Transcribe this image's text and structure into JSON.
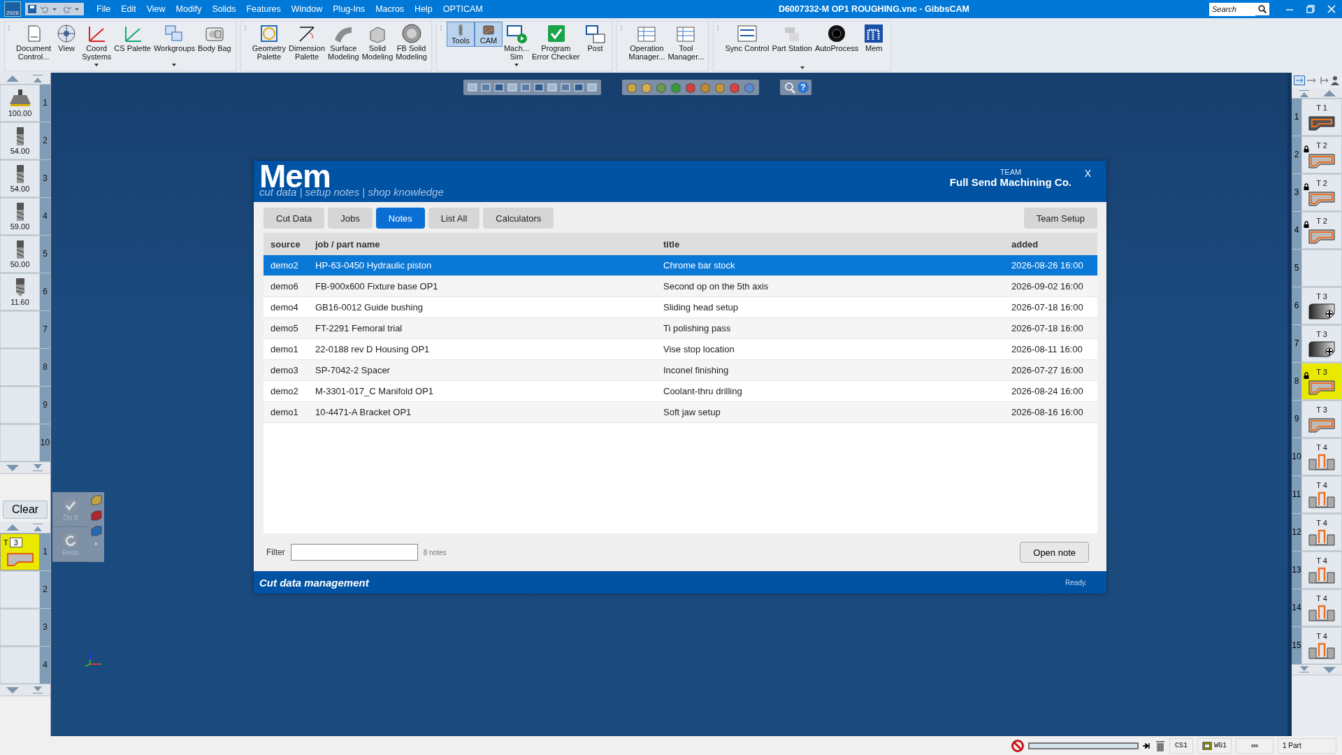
{
  "title_bar": {
    "app_badge": "2026",
    "menu": [
      "File",
      "Edit",
      "View",
      "Modify",
      "Solids",
      "Features",
      "Window",
      "Plug-Ins",
      "Macros",
      "Help",
      "OPTICAM"
    ],
    "title": "D6007332-M OP1 ROUGHING.vnc - GibbsCAM",
    "search_placeholder": "Search"
  },
  "toolbar": [
    {
      "buttons": [
        {
          "label": "Document\nControl...",
          "selected": false,
          "dropdown": false
        },
        {
          "label": "View",
          "selected": false,
          "dropdown": false
        },
        {
          "label": "Coord\nSystems",
          "selected": false,
          "dropdown": true
        },
        {
          "label": "CS Palette",
          "selected": false,
          "dropdown": false
        },
        {
          "label": "Workgroups",
          "selected": false,
          "dropdown": true
        },
        {
          "label": "Body Bag",
          "selected": false,
          "dropdown": false
        }
      ]
    },
    {
      "buttons": [
        {
          "label": "Geometry\nPalette",
          "selected": false,
          "dropdown": false
        },
        {
          "label": "Dimension\nPalette",
          "selected": false,
          "dropdown": false
        },
        {
          "label": "Surface\nModeling",
          "selected": false,
          "dropdown": false
        },
        {
          "label": "Solid\nModeling",
          "selected": false,
          "dropdown": false
        },
        {
          "label": "FB Solid\nModeling",
          "selected": false,
          "dropdown": false
        }
      ]
    },
    {
      "buttons": [
        {
          "label": "Tools",
          "selected": true,
          "dropdown": false
        },
        {
          "label": "CAM",
          "selected": true,
          "dropdown": false
        },
        {
          "label": "Mach...\nSim",
          "selected": false,
          "dropdown": true
        },
        {
          "label": "Program\nError Checker",
          "selected": false,
          "dropdown": false
        },
        {
          "label": "Post",
          "selected": false,
          "dropdown": false
        }
      ]
    },
    {
      "buttons": [
        {
          "label": "Operation\nManager...",
          "selected": false,
          "dropdown": false
        },
        {
          "label": "Tool\nManager...",
          "selected": false,
          "dropdown": false
        }
      ]
    },
    {
      "buttons": [
        {
          "label": "Sync Control",
          "selected": false,
          "dropdown": false
        },
        {
          "label": "Part Station",
          "selected": false,
          "dropdown": false
        },
        {
          "label": "AutoProcess",
          "selected": false,
          "dropdown": false
        },
        {
          "label": "Mem",
          "selected": false,
          "dropdown": false
        }
      ],
      "dropdown": true
    }
  ],
  "canvas_toolbar": {
    "help": "?"
  },
  "tool_list": [
    {
      "number": "1",
      "diameter": "100.00",
      "kind": "face_mill"
    },
    {
      "number": "2",
      "diameter": "54.00",
      "kind": "end_mill"
    },
    {
      "number": "3",
      "diameter": "54.00",
      "kind": "end_mill"
    },
    {
      "number": "4",
      "diameter": "59.00",
      "kind": "end_mill"
    },
    {
      "number": "5",
      "diameter": "50.00",
      "kind": "end_mill"
    },
    {
      "number": "6",
      "diameter": "11.60",
      "kind": "drill"
    },
    {
      "number": "7"
    },
    {
      "number": "8"
    },
    {
      "number": "9"
    },
    {
      "number": "10"
    }
  ],
  "clear_button": "Clear",
  "process_panel": {
    "do_it": "Do It",
    "redo": "Redo",
    "disabled": true
  },
  "process_list": [
    {
      "number": "1",
      "tool_label": "T",
      "tool": "3",
      "selected": true
    },
    {
      "number": "2",
      "selected": false
    },
    {
      "number": "3",
      "selected": false
    },
    {
      "number": "4",
      "selected": false
    }
  ],
  "operations": [
    {
      "number": "1",
      "tool": "T 1",
      "kind": "contour",
      "locked": false,
      "selected": false
    },
    {
      "number": "2",
      "tool": "T 2",
      "kind": "pocket",
      "locked": true,
      "selected": false
    },
    {
      "number": "3",
      "tool": "T 2",
      "kind": "pocket",
      "locked": true,
      "selected": false
    },
    {
      "number": "4",
      "tool": "T 2",
      "kind": "pocket",
      "locked": true,
      "selected": false
    },
    {
      "number": "5",
      "locked": false,
      "selected": false
    },
    {
      "number": "6",
      "tool": "T 3",
      "kind": "hole",
      "locked": false,
      "selected": false
    },
    {
      "number": "7",
      "tool": "T 3",
      "kind": "hole",
      "locked": false,
      "selected": false
    },
    {
      "number": "8",
      "tool": "T 3",
      "kind": "pocket",
      "locked": true,
      "selected": true
    },
    {
      "number": "9",
      "tool": "T 3",
      "kind": "pocket",
      "locked": false,
      "selected": false
    },
    {
      "number": "10",
      "tool": "T 4",
      "kind": "slot",
      "locked": false,
      "selected": false
    },
    {
      "number": "11",
      "tool": "T 4",
      "kind": "slot",
      "locked": false,
      "selected": false
    },
    {
      "number": "12",
      "tool": "T 4",
      "kind": "slot",
      "locked": false,
      "selected": false
    },
    {
      "number": "13",
      "tool": "T 4",
      "kind": "slot",
      "locked": false,
      "selected": false
    },
    {
      "number": "14",
      "tool": "T 4",
      "kind": "slot",
      "locked": false,
      "selected": false
    },
    {
      "number": "15",
      "tool": "T 4",
      "kind": "slot",
      "locked": false,
      "selected": false
    }
  ],
  "dialog": {
    "logo": "Mem",
    "tagline": "cut data | setup notes | shop knowledge",
    "team_label": "TEAM",
    "team_name": "Full Send Machining Co.",
    "close": "X",
    "tabs": [
      {
        "label": "Cut Data",
        "selected": false
      },
      {
        "label": "Jobs",
        "selected": false
      },
      {
        "label": "Notes",
        "selected": true
      },
      {
        "label": "List All",
        "selected": false
      },
      {
        "label": "Calculators",
        "selected": false
      }
    ],
    "team_setup": "Team Setup",
    "table": {
      "columns": [
        "source",
        "job / part name",
        "title",
        "added"
      ],
      "rows": [
        {
          "cells": [
            "demo2",
            "HP-63-0450 Hydraulic piston",
            "Chrome bar stock",
            "2026-08-26 16:00"
          ],
          "selected": true
        },
        {
          "cells": [
            "demo6",
            "FB-900x600 Fixture base OP1",
            "Second op on the 5th axis",
            "2026-09-02 16:00"
          ],
          "selected": false
        },
        {
          "cells": [
            "demo4",
            "GB16-0012 Guide bushing",
            "Sliding head setup",
            "2026-07-18 16:00"
          ],
          "selected": false
        },
        {
          "cells": [
            "demo5",
            "FT-2291 Femoral trial",
            "Ti polishing pass",
            "2026-07-18 16:00"
          ],
          "selected": false
        },
        {
          "cells": [
            "demo1",
            "22-0188 rev D Housing OP1",
            "Vise stop location",
            "2026-08-11 16:00"
          ],
          "selected": false
        },
        {
          "cells": [
            "demo3",
            "SP-7042-2 Spacer",
            "Inconel finishing",
            "2026-07-27 16:00"
          ],
          "selected": false
        },
        {
          "cells": [
            "demo2",
            "M-3301-017_C Manifold OP1",
            "Coolant-thru drilling",
            "2026-08-24 16:00"
          ],
          "selected": false
        },
        {
          "cells": [
            "demo1",
            "10-4471-A Bracket OP1",
            "Soft jaw setup",
            "2026-08-16 16:00"
          ],
          "selected": false
        }
      ]
    },
    "filter_label": "Filter",
    "count": "8 notes",
    "open_button": "Open note",
    "footer": "Cut data management",
    "status": "Ready."
  },
  "status_bar": {
    "progress": {
      "level": 0
    },
    "cs": "CS1",
    "wg": "WG1",
    "units": "mm",
    "parts": "1 Part"
  }
}
